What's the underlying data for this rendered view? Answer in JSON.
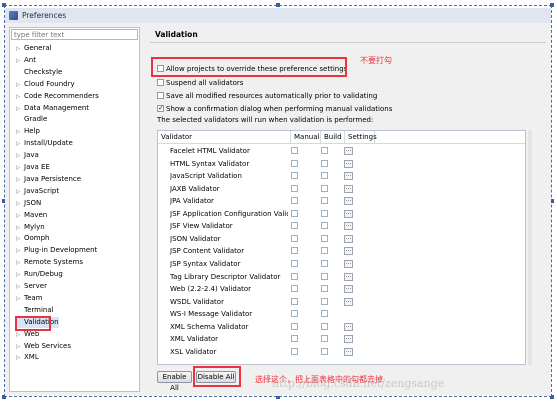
{
  "window": {
    "title": "Preferences"
  },
  "filter": {
    "placeholder": "type filter text"
  },
  "tree": [
    {
      "label": "General",
      "arrow": true
    },
    {
      "label": "Ant",
      "arrow": true
    },
    {
      "label": "Checkstyle",
      "arrow": false
    },
    {
      "label": "Cloud Foundry",
      "arrow": true
    },
    {
      "label": "Code Recommenders",
      "arrow": true
    },
    {
      "label": "Data Management",
      "arrow": true
    },
    {
      "label": "Gradle",
      "arrow": false
    },
    {
      "label": "Help",
      "arrow": true
    },
    {
      "label": "Install/Update",
      "arrow": true
    },
    {
      "label": "Java",
      "arrow": true
    },
    {
      "label": "Java EE",
      "arrow": true
    },
    {
      "label": "Java Persistence",
      "arrow": true
    },
    {
      "label": "JavaScript",
      "arrow": true
    },
    {
      "label": "JSON",
      "arrow": true
    },
    {
      "label": "Maven",
      "arrow": true
    },
    {
      "label": "Mylyn",
      "arrow": true
    },
    {
      "label": "Oomph",
      "arrow": true
    },
    {
      "label": "Plug-in Development",
      "arrow": true
    },
    {
      "label": "Remote Systems",
      "arrow": true
    },
    {
      "label": "Run/Debug",
      "arrow": true
    },
    {
      "label": "Server",
      "arrow": true
    },
    {
      "label": "Team",
      "arrow": true
    },
    {
      "label": "Terminal",
      "arrow": false
    },
    {
      "label": "Validation",
      "arrow": false,
      "selected": true
    },
    {
      "label": "Web",
      "arrow": true
    },
    {
      "label": "Web Services",
      "arrow": true
    },
    {
      "label": "XML",
      "arrow": true
    }
  ],
  "page": {
    "title": "Validation",
    "options": [
      {
        "label": "Allow projects to override these preference settings",
        "checked": false
      },
      {
        "label": "Suspend all validators",
        "checked": false
      },
      {
        "label": "Save all modified resources automatically prior to validating",
        "checked": false
      },
      {
        "label": "Show a confirmation dialog when performing manual validations",
        "checked": true
      }
    ],
    "selected_text": "The selected validators will run when validation is performed:"
  },
  "table": {
    "headers": [
      "Validator",
      "Manual",
      "Build",
      "Settings"
    ],
    "settings_glyph": "...",
    "rows": [
      "Facelet HTML Validator",
      "HTML Syntax Validator",
      "JavaScript Validation",
      "JAXB Validator",
      "JPA Validator",
      "JSF Application Configuration Valida...",
      "JSF View Validator",
      "JSON Validator",
      "JSP Content Validator",
      "JSP Syntax Validator",
      "Tag Library Descriptor Validator",
      "Web (2.2-2.4) Validator",
      "WSDL Validator",
      "WS-I Message Validator",
      "XML Schema Validator",
      "XML Validator",
      "XSL Validator"
    ]
  },
  "buttons": {
    "enable_all": "Enable All",
    "disable_all": "Disable All"
  },
  "annotations": {
    "top": "不要打勾",
    "bottom": "选择这个，把上面表格中的勾都去掉",
    "color": "#ee3340"
  },
  "watermark": "http://blog.csdn.net/zengsange"
}
